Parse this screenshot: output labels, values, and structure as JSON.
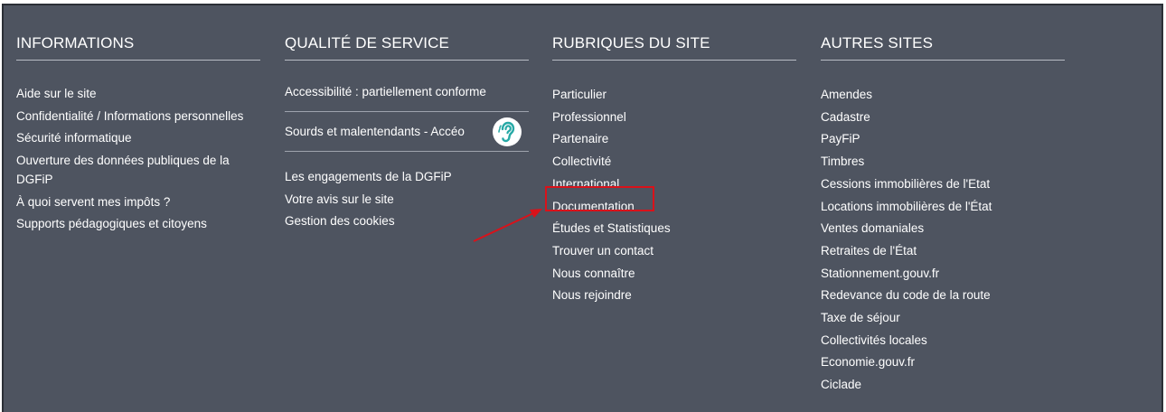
{
  "columns": {
    "informations": {
      "title": "INFORMATIONS",
      "links": [
        "Aide sur le site",
        "Confidentialité / Informations personnelles",
        "Sécurité informatique",
        "Ouverture des données publiques de la DGFiP",
        "À quoi servent mes impôts ?",
        "Supports pédagogiques et citoyens"
      ]
    },
    "qualite": {
      "title": "QUALITÉ DE SERVICE",
      "accessibilite": "Accessibilité : partiellement conforme",
      "acceo": "Sourds et malentendants - Accéo",
      "acceo_icon": "ear-icon",
      "links": [
        "Les engagements de la DGFiP",
        "Votre avis sur le site",
        "Gestion des cookies"
      ]
    },
    "rubriques": {
      "title": "RUBRIQUES DU SITE",
      "links": [
        "Particulier",
        "Professionnel",
        "Partenaire",
        "Collectivité",
        "International",
        "Documentation",
        "Études et Statistiques",
        "Trouver un contact",
        "Nous connaître",
        "Nous rejoindre"
      ]
    },
    "autres": {
      "title": "AUTRES SITES",
      "links": [
        "Amendes",
        "Cadastre",
        "PayFiP",
        "Timbres",
        "Cessions immobilières de l'Etat",
        "Locations immobilières de l'État",
        "Ventes domaniales",
        "Retraites de l'État",
        "Stationnement.gouv.fr",
        "Redevance du code de la route",
        "Taxe de séjour",
        "Collectivités locales",
        "Economie.gouv.fr",
        "Ciclade"
      ]
    }
  },
  "colors": {
    "background": "#4e5460",
    "text": "#ffffff",
    "highlight": "#d9121a",
    "ear_icon": "#27a9a6"
  }
}
